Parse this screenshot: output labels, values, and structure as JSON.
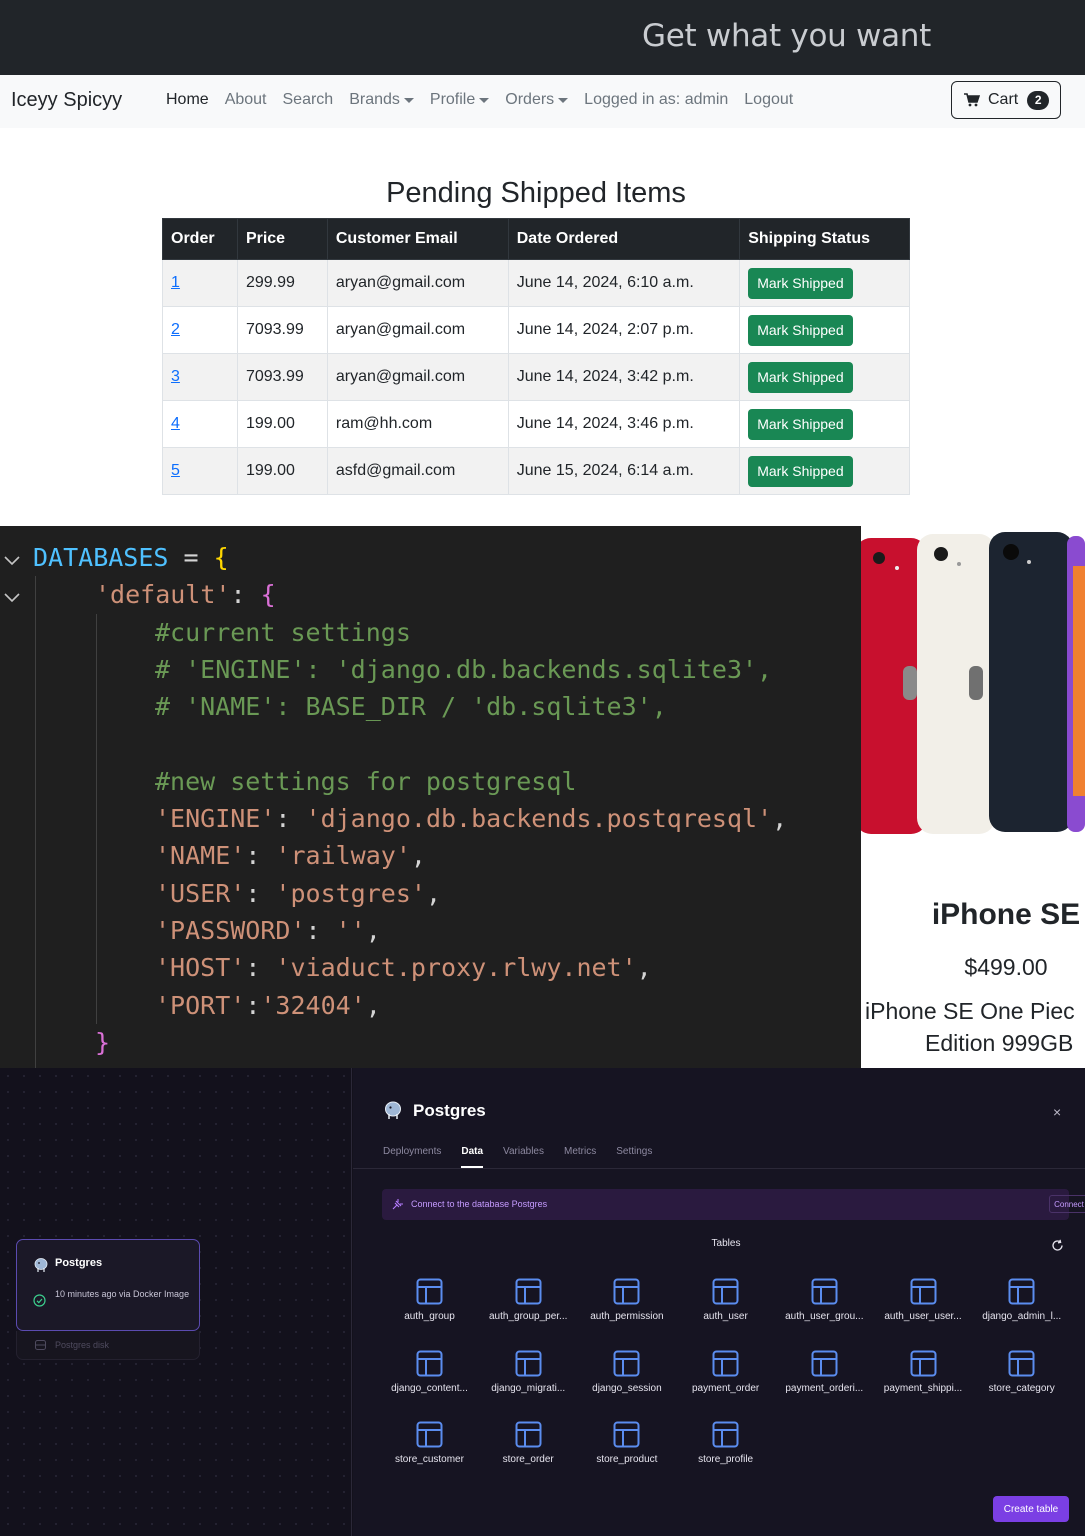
{
  "hero": {
    "tagline": "Get what you want"
  },
  "navbar": {
    "brand": "Iceyy Spicyy",
    "links": [
      {
        "label": "Home",
        "active": true,
        "dropdown": false
      },
      {
        "label": "About",
        "active": false,
        "dropdown": false
      },
      {
        "label": "Search",
        "active": false,
        "dropdown": false
      },
      {
        "label": "Brands",
        "active": false,
        "dropdown": true
      },
      {
        "label": "Profile",
        "active": false,
        "dropdown": true
      },
      {
        "label": "Orders",
        "active": false,
        "dropdown": true
      },
      {
        "label": "Logged in as: admin",
        "active": false,
        "dropdown": false
      },
      {
        "label": "Logout",
        "active": false,
        "dropdown": false
      }
    ],
    "cart": {
      "label": "Cart",
      "count": "2",
      "icon": "cart-icon"
    }
  },
  "orders": {
    "title": "Pending Shipped Items",
    "columns": [
      "Order",
      "Price",
      "Customer Email",
      "Date Ordered",
      "Shipping Status"
    ],
    "action_label": "Mark Shipped",
    "rows": [
      {
        "order": "1",
        "price": "299.99",
        "email": "aryan@gmail.com",
        "date": "June 14, 2024, 6:10 a.m."
      },
      {
        "order": "2",
        "price": "7093.99",
        "email": "aryan@gmail.com",
        "date": "June 14, 2024, 2:07 p.m."
      },
      {
        "order": "3",
        "price": "7093.99",
        "email": "aryan@gmail.com",
        "date": "June 14, 2024, 3:42 p.m."
      },
      {
        "order": "4",
        "price": "199.00",
        "email": "ram@hh.com",
        "date": "June 14, 2024, 3:46 p.m."
      },
      {
        "order": "5",
        "price": "199.00",
        "email": "asfd@gmail.com",
        "date": "June 15, 2024, 6:14 a.m."
      }
    ]
  },
  "code": {
    "lines": [
      {
        "text_parts": [
          [
            "DATABASES",
            "var"
          ],
          [
            " = ",
            "op"
          ],
          [
            "{",
            "brace1"
          ]
        ],
        "indent": 0
      },
      {
        "text_parts": [
          [
            "'default'",
            "str"
          ],
          [
            ": ",
            "punc"
          ],
          [
            "{",
            "brace2"
          ]
        ],
        "indent": 1
      },
      {
        "text_parts": [
          [
            "#current settings",
            "com"
          ]
        ],
        "indent": 2
      },
      {
        "text_parts": [
          [
            "# 'ENGINE': 'django.db.backends.sqlite3',",
            "com"
          ]
        ],
        "indent": 2
      },
      {
        "text_parts": [
          [
            "# 'NAME': BASE_DIR / 'db.sqlite3',",
            "com"
          ]
        ],
        "indent": 2
      },
      {
        "text_parts": [],
        "indent": 2
      },
      {
        "text_parts": [
          [
            "#new settings for postgresql",
            "com"
          ]
        ],
        "indent": 2
      },
      {
        "text_parts": [
          [
            "'ENGINE'",
            "str"
          ],
          [
            ": ",
            "punc"
          ],
          [
            "'django.db.backends.postqresql'",
            "str"
          ],
          [
            ",",
            "punc"
          ]
        ],
        "indent": 2
      },
      {
        "text_parts": [
          [
            "'NAME'",
            "str"
          ],
          [
            ": ",
            "punc"
          ],
          [
            "'railway'",
            "str"
          ],
          [
            ",",
            "punc"
          ]
        ],
        "indent": 2
      },
      {
        "text_parts": [
          [
            "'USER'",
            "str"
          ],
          [
            ": ",
            "punc"
          ],
          [
            "'postgres'",
            "str"
          ],
          [
            ",",
            "punc"
          ]
        ],
        "indent": 2
      },
      {
        "text_parts": [
          [
            "'PASSWORD'",
            "str"
          ],
          [
            ": ",
            "punc"
          ],
          [
            "''",
            "str"
          ],
          [
            ",",
            "punc"
          ]
        ],
        "indent": 2
      },
      {
        "text_parts": [
          [
            "'HOST'",
            "str"
          ],
          [
            ": ",
            "punc"
          ],
          [
            "'viaduct.proxy.rlwy.net'",
            "str"
          ],
          [
            ",",
            "punc"
          ]
        ],
        "indent": 2
      },
      {
        "text_parts": [
          [
            "'PORT'",
            "str"
          ],
          [
            ":",
            "punc"
          ],
          [
            "'32404'",
            "str"
          ],
          [
            ",",
            "punc"
          ]
        ],
        "indent": 2
      },
      {
        "text_parts": [
          [
            "}",
            "brace2"
          ]
        ],
        "indent": 1
      }
    ]
  },
  "product": {
    "name": "iPhone SE",
    "price": "$499.00",
    "desc_line1": "iPhone SE One Piec",
    "desc_line2": "Edition 999GB",
    "phone_colors": [
      "#c8102e",
      "#f2efe8",
      "#1c2430"
    ]
  },
  "railway": {
    "service_card": {
      "name": "Postgres",
      "status": "10 minutes ago via Docker Image",
      "disk": "Postgres disk"
    },
    "panel": {
      "title": "Postgres",
      "close": "×",
      "tabs": [
        {
          "label": "Deployments",
          "active": false
        },
        {
          "label": "Data",
          "active": true
        },
        {
          "label": "Variables",
          "active": false
        },
        {
          "label": "Metrics",
          "active": false
        },
        {
          "label": "Settings",
          "active": false
        }
      ],
      "connect_text": "Connect to the database Postgres",
      "connect_button": "Connect",
      "tables_label": "Tables",
      "tables": [
        "auth_group",
        "auth_group_per...",
        "auth_permission",
        "auth_user",
        "auth_user_grou...",
        "auth_user_user...",
        "django_admin_l...",
        "django_content...",
        "django_migrati...",
        "django_session",
        "payment_order",
        "payment_orderi...",
        "payment_shippi...",
        "store_category",
        "store_customer",
        "store_order",
        "store_product",
        "store_profile"
      ],
      "create_button": "Create table"
    },
    "accent": "#7b3fe4",
    "table_icon_color": "#5b8def"
  }
}
